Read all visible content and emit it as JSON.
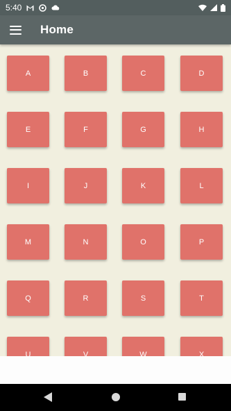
{
  "status_bar": {
    "time": "5:40",
    "left_icons": [
      "gmail-icon",
      "sync-icon",
      "cloud-icon"
    ],
    "right_icons": [
      "wifi-icon",
      "signal-icon",
      "battery-icon"
    ]
  },
  "app_bar": {
    "menu_icon": "hamburger-menu-icon",
    "title": "Home"
  },
  "colors": {
    "status_bar": "#535e5e",
    "app_bar": "#5c6666",
    "background": "#f1efdf",
    "key": "#e0726a",
    "key_text": "#ffffff"
  },
  "keys": [
    "A",
    "B",
    "C",
    "D",
    "E",
    "F",
    "G",
    "H",
    "I",
    "J",
    "K",
    "L",
    "M",
    "N",
    "O",
    "P",
    "Q",
    "R",
    "S",
    "T",
    "U",
    "V",
    "W",
    "X"
  ],
  "nav_bar": {
    "icons": [
      "back-icon",
      "home-icon",
      "recents-icon"
    ]
  }
}
